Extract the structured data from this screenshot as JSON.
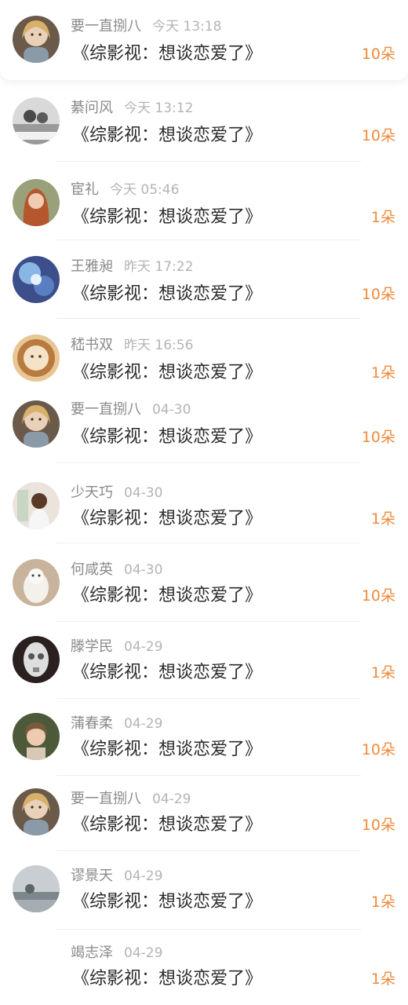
{
  "colors": {
    "accent": "#f08a3c",
    "title": "#2b2b2b",
    "meta": "#8e8e8e",
    "time": "#b4b4b4"
  },
  "rows": [
    {
      "name": "要一直捌八",
      "time": "今天 13:18",
      "title": "《综影视：想谈恋爱了》",
      "count": "10朵",
      "avatar": "girl-illustration-avatar"
    },
    {
      "name": "綦问风",
      "time": "今天 13:12",
      "title": "《综影视：想谈恋爱了》",
      "count": "10朵",
      "avatar": "couple-photo-avatar"
    },
    {
      "name": "宦礼",
      "time": "今天 05:46",
      "title": "《综影视：想谈恋爱了》",
      "count": "1朵",
      "avatar": "redhead-girl-avatar"
    },
    {
      "name": "王雅昶",
      "time": "昨天 17:22",
      "title": "《综影视：想谈恋爱了》",
      "count": "10朵",
      "avatar": "flower-avatar"
    },
    {
      "name": "嵇书双",
      "time": "昨天 16:56",
      "title": "《综影视：想谈恋爱了》",
      "count": "1朵",
      "avatar": "latte-art-avatar"
    },
    {
      "name": "要一直捌八",
      "time": "04-30",
      "title": "《综影视：想谈恋爱了》",
      "count": "10朵",
      "avatar": "girl-illustration-avatar"
    },
    {
      "name": "少天巧",
      "time": "04-30",
      "title": "《综影视：想谈恋爱了》",
      "count": "1朵",
      "avatar": "girl-back-avatar"
    },
    {
      "name": "何咸英",
      "time": "04-30",
      "title": "《综影视：想谈恋爱了》",
      "count": "10朵",
      "avatar": "cat-avatar"
    },
    {
      "name": "滕学民",
      "time": "04-29",
      "title": "《综影视：想谈恋爱了》",
      "count": "1朵",
      "avatar": "skull-avatar"
    },
    {
      "name": "蒲春柔",
      "time": "04-29",
      "title": "《综影视：想谈恋爱了》",
      "count": "10朵",
      "avatar": "woman-portrait-avatar"
    },
    {
      "name": "要一直捌八",
      "time": "04-29",
      "title": "《综影视：想谈恋爱了》",
      "count": "10朵",
      "avatar": "girl-illustration-avatar"
    },
    {
      "name": "谬景天",
      "time": "04-29",
      "title": "《综影视：想谈恋爱了》",
      "count": "1朵",
      "avatar": "misty-landscape-avatar"
    },
    {
      "name": "竭志泽",
      "time": "04-29",
      "title": "《综影视：想谈恋爱了》",
      "count": "1朵",
      "avatar": "none"
    }
  ]
}
